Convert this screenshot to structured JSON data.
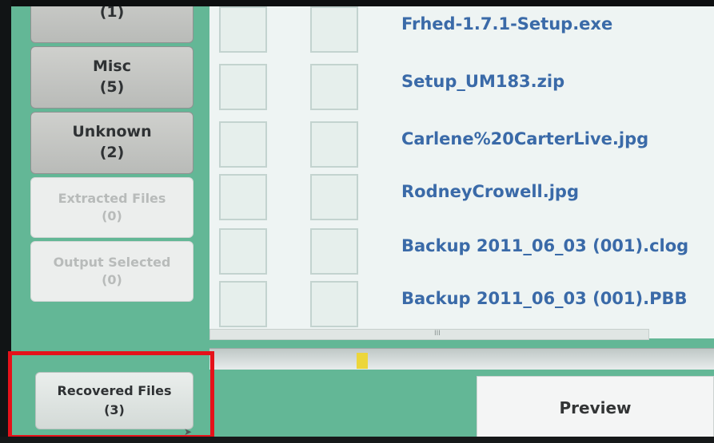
{
  "categories": [
    {
      "label": "",
      "count": "(1)",
      "state": "active"
    },
    {
      "label": "Misc",
      "count": "(5)",
      "state": "active"
    },
    {
      "label": "Unknown",
      "count": "(2)",
      "state": "active"
    },
    {
      "label": "Extracted Files",
      "count": "(0)",
      "state": "disabled"
    },
    {
      "label": "Output Selected",
      "count": "(0)",
      "state": "disabled"
    }
  ],
  "files": [
    {
      "name": "Frhed-1.7.1-Setup.exe"
    },
    {
      "name": "Setup_UM183.zip"
    },
    {
      "name": "Carlene%20CarterLive.jpg"
    },
    {
      "name": "RodneyCrowell.jpg"
    },
    {
      "name": "Backup 2011_06_03 (001).clog"
    },
    {
      "name": "Backup 2011_06_03 (001).PBB"
    }
  ],
  "scrollbar": {
    "thumb_text": "III"
  },
  "recovered": {
    "label": "Recovered Files",
    "count": "(3)"
  },
  "preview": {
    "label": "Preview"
  },
  "colors": {
    "background": "#63b796",
    "highlight": "#e5121a",
    "filename": "#3a6aa8",
    "marker": "#ecd63a"
  }
}
